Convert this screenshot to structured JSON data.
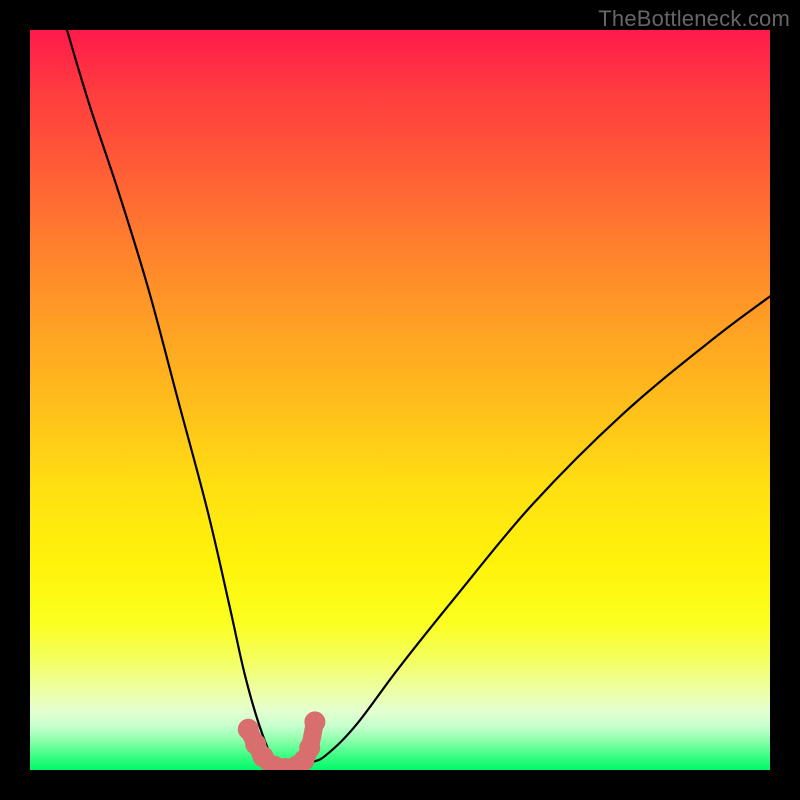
{
  "watermark": "TheBottleneck.com",
  "colors": {
    "frame": "#000000",
    "curve": "#000000",
    "markers": "#d96e6e",
    "gradient_top": "#ff1a4b",
    "gradient_bottom": "#00f86a"
  },
  "chart_data": {
    "type": "line",
    "title": "",
    "xlabel": "",
    "ylabel": "",
    "xlim": [
      0,
      100
    ],
    "ylim": [
      0,
      100
    ],
    "note": "Axes are unlabeled in the source image; values below are visual estimates on a 0–100 scale. The curve depicts a bottleneck/mismatch percentage that drops to ~0 at x≈34 (the optimal match) and rises on either side.",
    "series": [
      {
        "name": "bottleneck-curve",
        "x": [
          5,
          8,
          12,
          16,
          20,
          24,
          27,
          29,
          31,
          33,
          34,
          36,
          38,
          40,
          44,
          50,
          58,
          68,
          80,
          92,
          100
        ],
        "y": [
          100,
          90,
          78,
          65,
          50,
          35,
          22,
          13,
          6,
          1,
          0,
          0,
          1,
          2,
          6,
          14,
          24,
          36,
          48,
          58,
          64
        ]
      }
    ],
    "markers": {
      "name": "optimal-zone",
      "x": [
        29.5,
        30.5,
        31.5,
        33.0,
        34.5,
        36.0,
        37.0,
        37.8,
        38.5
      ],
      "y": [
        5.5,
        3.5,
        1.8,
        0.5,
        0.2,
        0.5,
        1.3,
        3.0,
        6.5
      ]
    }
  }
}
